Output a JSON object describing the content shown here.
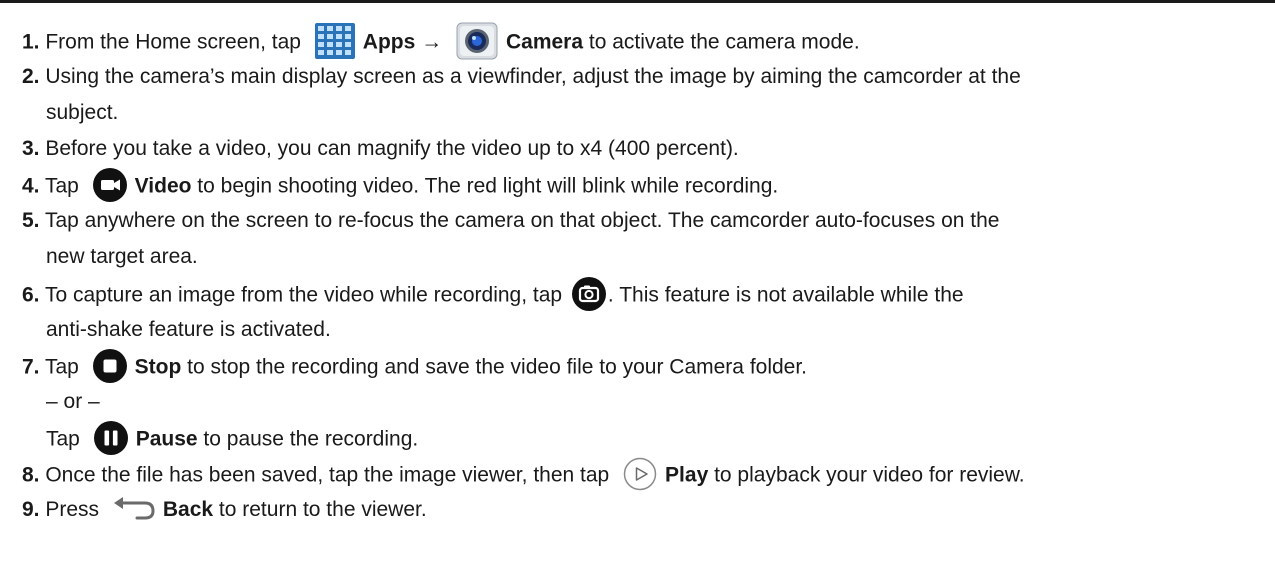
{
  "steps": [
    {
      "num": "1.",
      "t1": " From the Home screen, tap ",
      "apps_label": "Apps",
      "arrow": " → ",
      "camera_label": "Camera",
      "t2": " to activate the camera mode.",
      "apps_icon": "apps-grid-icon",
      "camera_icon": "camera-app-icon"
    },
    {
      "num": "2.",
      "text": " Using the camera’s main display screen as a viewfinder, adjust the image by aiming the camcorder at the",
      "cont": "subject."
    },
    {
      "num": "3.",
      "text": " Before you take a video, you can magnify the video up to x4 (400 percent)."
    },
    {
      "num": "4.",
      "t1": " Tap ",
      "label": "Video",
      "t2": " to begin shooting video. The red light will blink while recording.",
      "icon": "video-record-icon"
    },
    {
      "num": "5.",
      "text": " Tap anywhere on the screen to re-focus the camera on that object. The camcorder auto-focuses on the",
      "cont": "new target area."
    },
    {
      "num": "6.",
      "t1": " To capture an image from the video while recording, tap ",
      "t2": ". This feature is not available while the",
      "cont": "anti-shake feature is activated.",
      "icon": "capture-photo-icon"
    },
    {
      "num": "7.",
      "t1": " Tap ",
      "label": "Stop",
      "t2": " to stop the recording and save the video file to your Camera folder.",
      "or": "– or –",
      "alt_t1": "Tap ",
      "alt_label": "Pause",
      "alt_t2": " to pause the recording.",
      "icon": "stop-icon",
      "alt_icon": "pause-icon"
    },
    {
      "num": "8.",
      "t1": " Once the file has been saved, tap the image viewer, then tap ",
      "label": "Play",
      "t2": " to playback your video for review.",
      "icon": "play-icon"
    },
    {
      "num": "9.",
      "t1": " Press ",
      "label": "Back",
      "t2": " to return to the viewer.",
      "icon": "back-icon"
    }
  ]
}
